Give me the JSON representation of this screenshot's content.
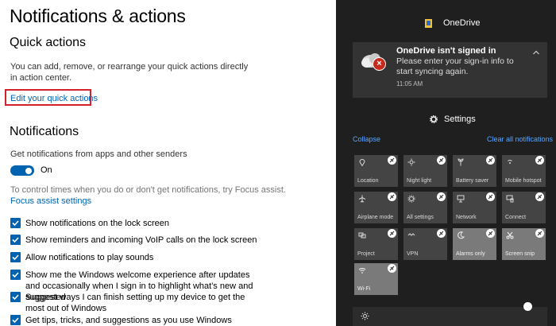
{
  "settings": {
    "page_title": "Notifications & actions",
    "quick_actions": {
      "heading": "Quick actions",
      "description": "You can add, remove, or rearrange your quick actions directly in action center.",
      "edit_link": "Edit your quick actions"
    },
    "notifications": {
      "heading": "Notifications",
      "get_label": "Get notifications from apps and other senders",
      "toggle_state": "On",
      "focus_hint": "To control times when you do or don't get notifications, try Focus assist.",
      "focus_link": "Focus assist settings",
      "checkboxes": [
        {
          "label": "Show notifications on the lock screen",
          "checked": true
        },
        {
          "label": "Show reminders and incoming VoIP calls on the lock screen",
          "checked": true
        },
        {
          "label": "Allow notifications to play sounds",
          "checked": true
        },
        {
          "label": "Show me the Windows welcome experience after updates and occasionally when I sign in to highlight what's new and suggested",
          "checked": true
        },
        {
          "label": "Suggest ways I can finish setting up my device to get the most out of Windows",
          "checked": true
        },
        {
          "label": "Get tips, tricks, and suggestions as you use Windows",
          "checked": true
        }
      ]
    }
  },
  "action_center": {
    "app_header": "OneDrive",
    "toast": {
      "title": "OneDrive isn't signed in",
      "body": "Please enter your sign-in info to start syncing again.",
      "time": "11:05 AM"
    },
    "settings_label": "Settings",
    "collapse_label": "Collapse",
    "clear_all_label": "Clear all notifications",
    "tiles": [
      {
        "label": "Location",
        "active": false,
        "icon": "location-icon"
      },
      {
        "label": "Night light",
        "active": false,
        "icon": "brightness-icon"
      },
      {
        "label": "Battery saver",
        "active": false,
        "icon": "battery-saver-icon"
      },
      {
        "label": "Mobile hotspot",
        "active": false,
        "icon": "hotspot-icon"
      },
      {
        "label": "Airplane mode",
        "active": false,
        "icon": "airplane-icon"
      },
      {
        "label": "All settings",
        "active": false,
        "icon": "gear-icon"
      },
      {
        "label": "Network",
        "active": false,
        "icon": "network-icon"
      },
      {
        "label": "Connect",
        "active": false,
        "icon": "connect-icon"
      },
      {
        "label": "Project",
        "active": false,
        "icon": "project-icon"
      },
      {
        "label": "VPN",
        "active": false,
        "icon": "vpn-icon"
      },
      {
        "label": "Alarms only",
        "active": true,
        "icon": "moon-icon"
      },
      {
        "label": "Screen snip",
        "active": true,
        "icon": "scissors-icon"
      },
      {
        "label": "Wi-Fi",
        "active": true,
        "icon": "wifi-icon"
      }
    ]
  },
  "colors": {
    "accent": "#0063b1",
    "highlight_box": "#d2232a",
    "action_center_bg": "#1f1f1f",
    "link_on_dark": "#5aa6ff",
    "error": "#c42b1c"
  }
}
